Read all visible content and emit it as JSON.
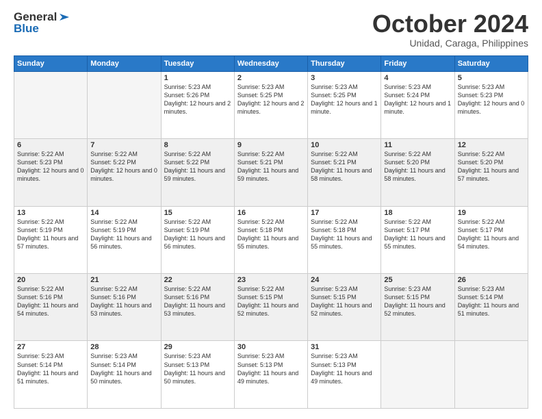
{
  "header": {
    "logo_line1": "General",
    "logo_line2": "Blue",
    "month": "October 2024",
    "location": "Unidad, Caraga, Philippines"
  },
  "weekdays": [
    "Sunday",
    "Monday",
    "Tuesday",
    "Wednesday",
    "Thursday",
    "Friday",
    "Saturday"
  ],
  "weeks": [
    [
      {
        "day": "",
        "text": ""
      },
      {
        "day": "",
        "text": ""
      },
      {
        "day": "1",
        "text": "Sunrise: 5:23 AM\nSunset: 5:26 PM\nDaylight: 12 hours\nand 2 minutes."
      },
      {
        "day": "2",
        "text": "Sunrise: 5:23 AM\nSunset: 5:25 PM\nDaylight: 12 hours\nand 2 minutes."
      },
      {
        "day": "3",
        "text": "Sunrise: 5:23 AM\nSunset: 5:25 PM\nDaylight: 12 hours\nand 1 minute."
      },
      {
        "day": "4",
        "text": "Sunrise: 5:23 AM\nSunset: 5:24 PM\nDaylight: 12 hours\nand 1 minute."
      },
      {
        "day": "5",
        "text": "Sunrise: 5:23 AM\nSunset: 5:23 PM\nDaylight: 12 hours\nand 0 minutes."
      }
    ],
    [
      {
        "day": "6",
        "text": "Sunrise: 5:22 AM\nSunset: 5:23 PM\nDaylight: 12 hours\nand 0 minutes."
      },
      {
        "day": "7",
        "text": "Sunrise: 5:22 AM\nSunset: 5:22 PM\nDaylight: 12 hours\nand 0 minutes."
      },
      {
        "day": "8",
        "text": "Sunrise: 5:22 AM\nSunset: 5:22 PM\nDaylight: 11 hours\nand 59 minutes."
      },
      {
        "day": "9",
        "text": "Sunrise: 5:22 AM\nSunset: 5:21 PM\nDaylight: 11 hours\nand 59 minutes."
      },
      {
        "day": "10",
        "text": "Sunrise: 5:22 AM\nSunset: 5:21 PM\nDaylight: 11 hours\nand 58 minutes."
      },
      {
        "day": "11",
        "text": "Sunrise: 5:22 AM\nSunset: 5:20 PM\nDaylight: 11 hours\nand 58 minutes."
      },
      {
        "day": "12",
        "text": "Sunrise: 5:22 AM\nSunset: 5:20 PM\nDaylight: 11 hours\nand 57 minutes."
      }
    ],
    [
      {
        "day": "13",
        "text": "Sunrise: 5:22 AM\nSunset: 5:19 PM\nDaylight: 11 hours\nand 57 minutes."
      },
      {
        "day": "14",
        "text": "Sunrise: 5:22 AM\nSunset: 5:19 PM\nDaylight: 11 hours\nand 56 minutes."
      },
      {
        "day": "15",
        "text": "Sunrise: 5:22 AM\nSunset: 5:19 PM\nDaylight: 11 hours\nand 56 minutes."
      },
      {
        "day": "16",
        "text": "Sunrise: 5:22 AM\nSunset: 5:18 PM\nDaylight: 11 hours\nand 55 minutes."
      },
      {
        "day": "17",
        "text": "Sunrise: 5:22 AM\nSunset: 5:18 PM\nDaylight: 11 hours\nand 55 minutes."
      },
      {
        "day": "18",
        "text": "Sunrise: 5:22 AM\nSunset: 5:17 PM\nDaylight: 11 hours\nand 55 minutes."
      },
      {
        "day": "19",
        "text": "Sunrise: 5:22 AM\nSunset: 5:17 PM\nDaylight: 11 hours\nand 54 minutes."
      }
    ],
    [
      {
        "day": "20",
        "text": "Sunrise: 5:22 AM\nSunset: 5:16 PM\nDaylight: 11 hours\nand 54 minutes."
      },
      {
        "day": "21",
        "text": "Sunrise: 5:22 AM\nSunset: 5:16 PM\nDaylight: 11 hours\nand 53 minutes."
      },
      {
        "day": "22",
        "text": "Sunrise: 5:22 AM\nSunset: 5:16 PM\nDaylight: 11 hours\nand 53 minutes."
      },
      {
        "day": "23",
        "text": "Sunrise: 5:22 AM\nSunset: 5:15 PM\nDaylight: 11 hours\nand 52 minutes."
      },
      {
        "day": "24",
        "text": "Sunrise: 5:23 AM\nSunset: 5:15 PM\nDaylight: 11 hours\nand 52 minutes."
      },
      {
        "day": "25",
        "text": "Sunrise: 5:23 AM\nSunset: 5:15 PM\nDaylight: 11 hours\nand 52 minutes."
      },
      {
        "day": "26",
        "text": "Sunrise: 5:23 AM\nSunset: 5:14 PM\nDaylight: 11 hours\nand 51 minutes."
      }
    ],
    [
      {
        "day": "27",
        "text": "Sunrise: 5:23 AM\nSunset: 5:14 PM\nDaylight: 11 hours\nand 51 minutes."
      },
      {
        "day": "28",
        "text": "Sunrise: 5:23 AM\nSunset: 5:14 PM\nDaylight: 11 hours\nand 50 minutes."
      },
      {
        "day": "29",
        "text": "Sunrise: 5:23 AM\nSunset: 5:13 PM\nDaylight: 11 hours\nand 50 minutes."
      },
      {
        "day": "30",
        "text": "Sunrise: 5:23 AM\nSunset: 5:13 PM\nDaylight: 11 hours\nand 49 minutes."
      },
      {
        "day": "31",
        "text": "Sunrise: 5:23 AM\nSunset: 5:13 PM\nDaylight: 11 hours\nand 49 minutes."
      },
      {
        "day": "",
        "text": ""
      },
      {
        "day": "",
        "text": ""
      }
    ]
  ]
}
